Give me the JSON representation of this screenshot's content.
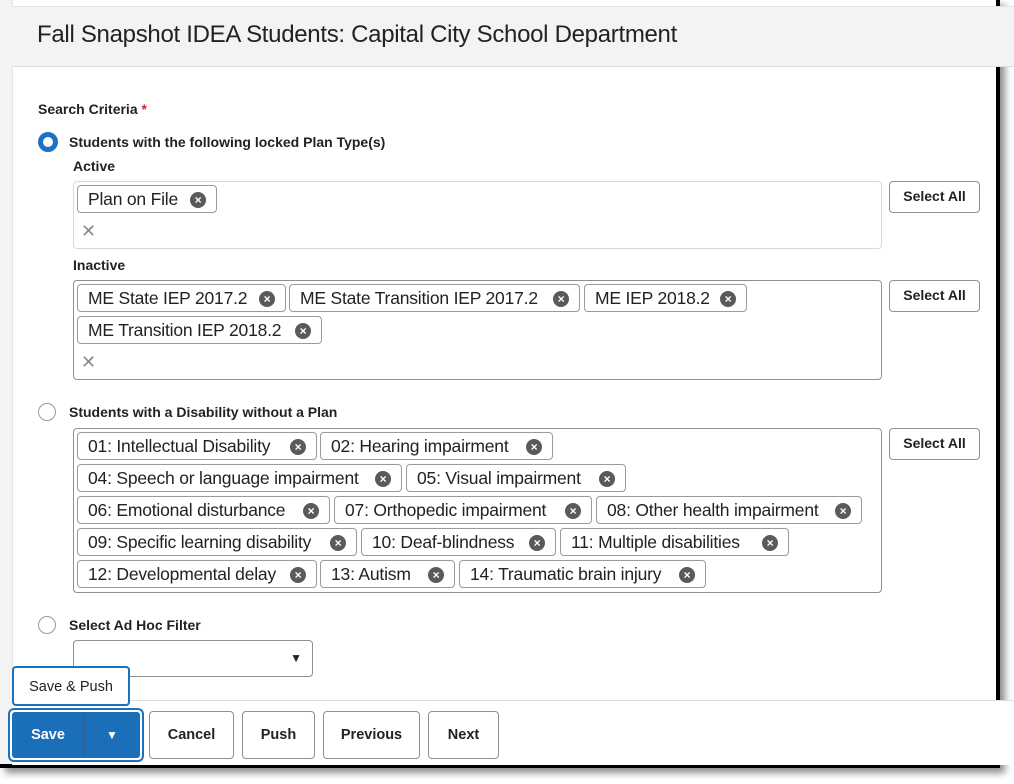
{
  "header": {
    "title": "Fall Snapshot IDEA Students: Capital City School Department"
  },
  "search_criteria": {
    "label": "Search Criteria",
    "required_marker": "*",
    "options": [
      {
        "label": "Students with the following locked Plan Type(s)",
        "selected": true,
        "groups": [
          {
            "label": "Active",
            "chips": [
              "Plan on File"
            ],
            "select_all_label": "Select All"
          },
          {
            "label": "Inactive",
            "chips": [
              "ME State IEP 2017.2",
              "ME State Transition IEP 2017.2",
              "ME IEP 2018.2",
              "ME Transition IEP 2018.2"
            ],
            "select_all_label": "Select All"
          }
        ]
      },
      {
        "label": "Students with a Disability without a Plan",
        "selected": false,
        "chips": [
          "01: Intellectual Disability",
          "02: Hearing impairment",
          "04: Speech or language impairment",
          "05: Visual impairment",
          "06: Emotional disturbance",
          "07: Orthopedic impairment",
          "08: Other health impairment",
          "09: Specific learning disability",
          "10: Deaf-blindness",
          "11: Multiple disabilities",
          "12: Developmental delay",
          "13: Autism",
          "14: Traumatic brain injury"
        ],
        "select_all_label": "Select All"
      },
      {
        "label": "Select Ad Hoc Filter",
        "selected": false,
        "dropdown_value": ""
      }
    ],
    "chip_remove_icon": "×",
    "clear_icon": "✕"
  },
  "footer": {
    "save_label": "Save",
    "save_menu": [
      "Save & Push"
    ],
    "dropdown_icon": "▼",
    "buttons": [
      "Cancel",
      "Push",
      "Previous",
      "Next"
    ]
  },
  "colors": {
    "accent": "#1a6fb8",
    "required": "#d2232a"
  }
}
